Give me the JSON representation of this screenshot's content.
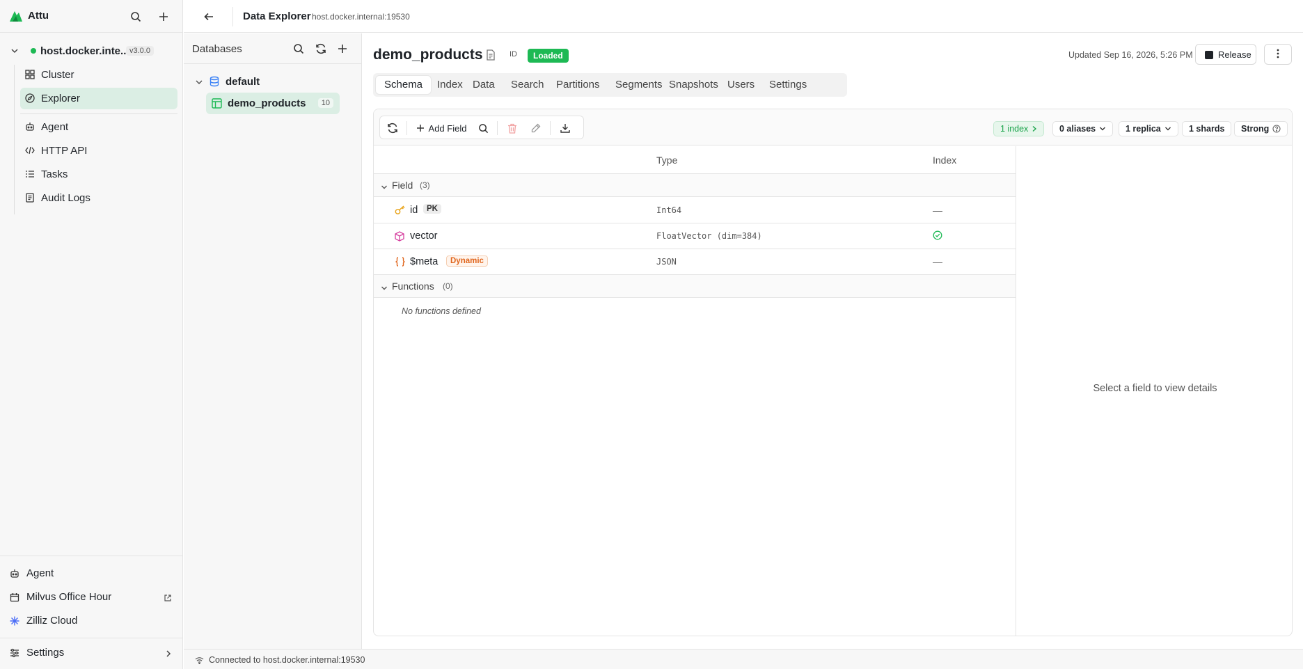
{
  "app": {
    "name": "Attu"
  },
  "connection": {
    "host": "host.docker.inte...",
    "version": "v3.0.0"
  },
  "nav": {
    "items": [
      {
        "label": "Cluster",
        "icon": "grid-icon"
      },
      {
        "label": "Explorer",
        "icon": "compass-icon",
        "active": true
      },
      {
        "label": "Agent",
        "icon": "robot-icon"
      },
      {
        "label": "HTTP API",
        "icon": "code-icon"
      },
      {
        "label": "Tasks",
        "icon": "list-icon"
      },
      {
        "label": "Audit Logs",
        "icon": "log-icon"
      }
    ],
    "footer": [
      {
        "label": "Agent",
        "icon": "robot-icon"
      },
      {
        "label": "Milvus Office Hour",
        "icon": "calendar-icon"
      },
      {
        "label": "Zilliz Cloud",
        "icon": "sparkle-icon"
      }
    ],
    "settings_label": "Settings"
  },
  "topbar": {
    "title": "Data Explorer",
    "subtitle": "host.docker.internal:19530"
  },
  "databases": {
    "header": "Databases",
    "db_name": "default",
    "collection": {
      "name": "demo_products",
      "count": "10"
    }
  },
  "collection": {
    "name": "demo_products",
    "id_label": "ID",
    "status": "Loaded",
    "updated": "Updated Sep 16, 2026, 5:26 PM",
    "release_label": "Release"
  },
  "tabs": [
    "Schema",
    "Index",
    "Data",
    "Search",
    "Partitions",
    "Segments",
    "Snapshots",
    "Users",
    "Settings"
  ],
  "toolbar": {
    "add_field_label": "Add Field",
    "pills": {
      "index": "1 index",
      "aliases": "0 aliases",
      "replica": "1 replica",
      "shards": "1 shards",
      "consistency": "Strong"
    }
  },
  "table": {
    "headers": {
      "type": "Type",
      "index": "Index"
    },
    "field_group": {
      "label": "Field",
      "count": "(3)"
    },
    "fields": [
      {
        "name": "id",
        "tag": "PK",
        "type": "Int64",
        "index": "—"
      },
      {
        "name": "vector",
        "tag": "",
        "type": "FloatVector (dim=384)",
        "index": ""
      },
      {
        "name": "$meta",
        "tag": "Dynamic",
        "type": "JSON",
        "index": "—"
      }
    ],
    "functions_group": {
      "label": "Functions",
      "count": "(0)"
    },
    "no_functions": "No functions defined"
  },
  "details": {
    "placeholder": "Select a field to view details"
  },
  "status": {
    "text": "Connected to host.docker.internal:19530"
  },
  "colors": {
    "accent": "#1db954",
    "active_bg": "#dbeee4",
    "dynamic": "#e0651c",
    "key_icon": "#e8a317",
    "vector_icon": "#d6409f"
  }
}
